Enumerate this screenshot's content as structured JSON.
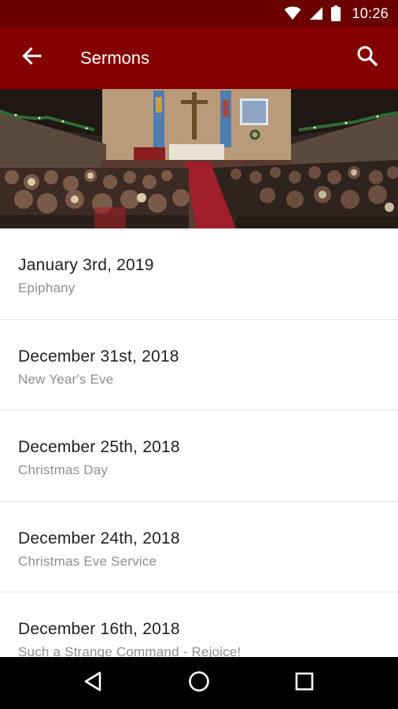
{
  "status_bar": {
    "time": "10:26",
    "icons": [
      "wifi-icon",
      "signal-icon",
      "battery-icon"
    ]
  },
  "app_bar": {
    "title": "Sermons",
    "back_icon": "arrow-left-icon",
    "search_icon": "search-icon"
  },
  "sermons": [
    {
      "date": "January 3rd, 2019",
      "subtitle": "Epiphany"
    },
    {
      "date": "December 31st, 2018",
      "subtitle": "New Year's Eve"
    },
    {
      "date": "December 25th, 2018",
      "subtitle": "Christmas Day"
    },
    {
      "date": "December 24th, 2018",
      "subtitle": "Christmas Eve Service"
    },
    {
      "date": "December 16th, 2018",
      "subtitle": "Such a Strange Command - Rejoice!"
    }
  ],
  "nav_bar": {
    "icons": [
      "back-triangle-icon",
      "home-circle-icon",
      "recents-square-icon"
    ]
  },
  "colors": {
    "app_bar": "#850000",
    "status_bar": "#6b0000",
    "title_text": "#ffffff",
    "list_primary_text": "#212121",
    "list_secondary_text": "#8f8f8f"
  }
}
